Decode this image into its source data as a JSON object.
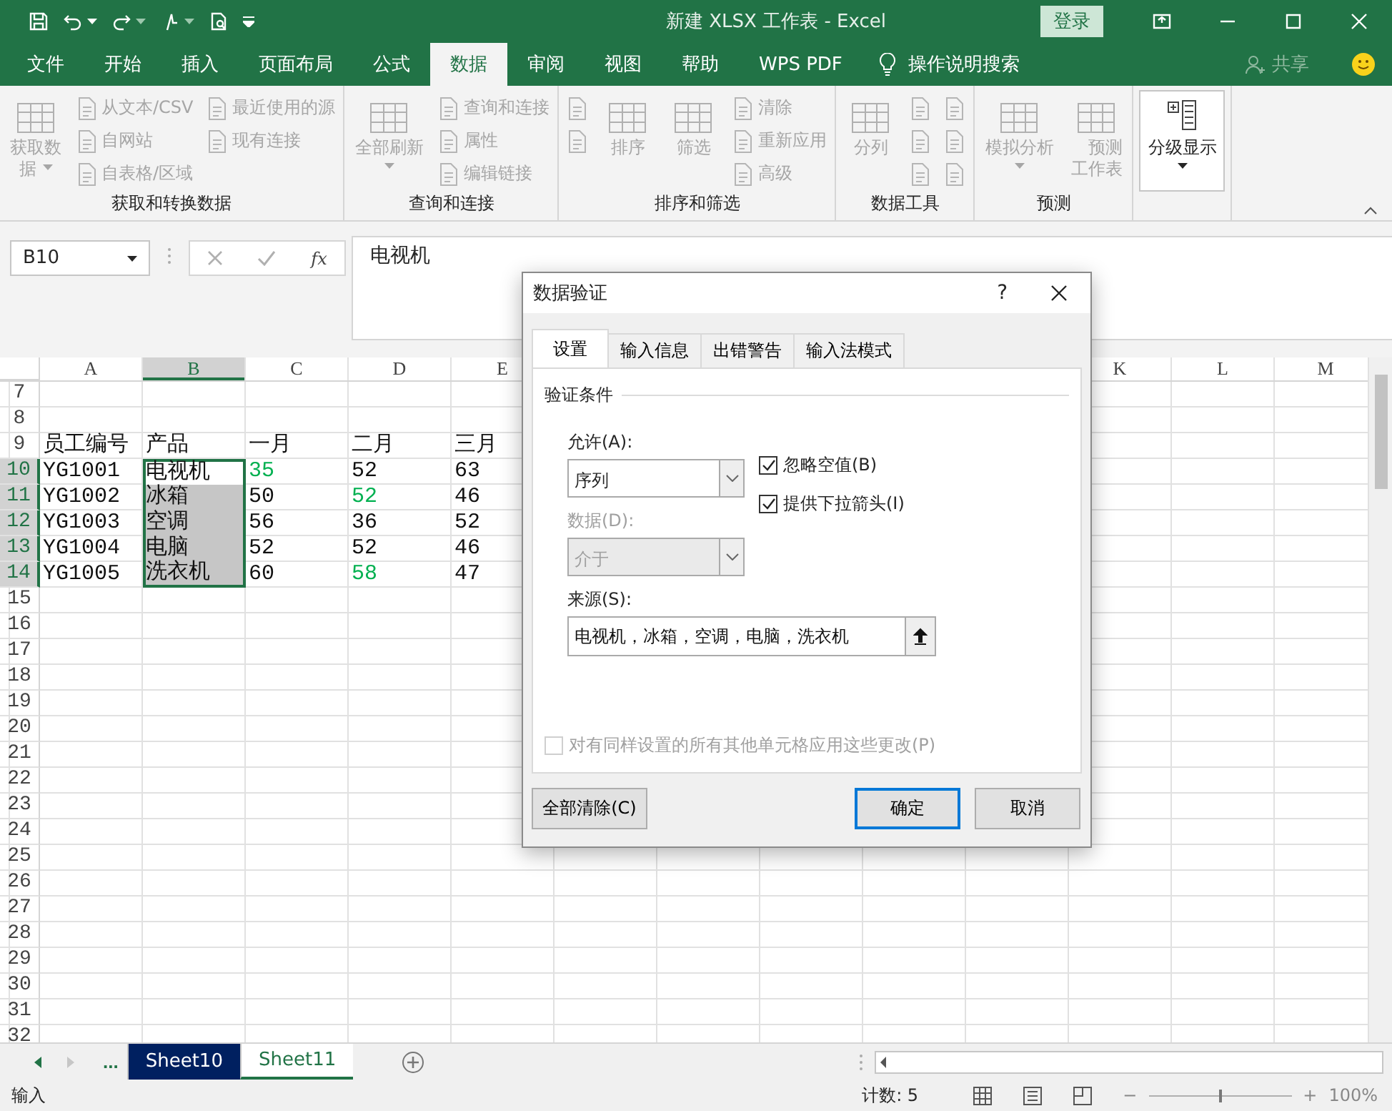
{
  "window": {
    "title": "新建 XLSX 工作表  -  Excel",
    "login": "登录"
  },
  "menu": {
    "tabs": [
      {
        "label": "文件",
        "selected": false
      },
      {
        "label": "开始",
        "selected": false
      },
      {
        "label": "插入",
        "selected": false
      },
      {
        "label": "页面布局",
        "selected": false
      },
      {
        "label": "公式",
        "selected": false
      },
      {
        "label": "数据",
        "selected": true
      },
      {
        "label": "审阅",
        "selected": false
      },
      {
        "label": "视图",
        "selected": false
      },
      {
        "label": "帮助",
        "selected": false
      },
      {
        "label": "WPS PDF",
        "selected": false
      }
    ],
    "search": "操作说明搜索",
    "share": "共享"
  },
  "ribbon": {
    "groups": [
      {
        "label": "获取和转换数据",
        "columns": [
          {
            "kind": "large",
            "label": "获取数据",
            "dropdown": true,
            "disabled": true
          },
          {
            "kind": "stack",
            "entries": [
              {
                "label": "从文本/CSV",
                "disabled": true
              },
              {
                "label": "自网站",
                "disabled": true
              },
              {
                "label": "自表格/区域",
                "disabled": true
              }
            ]
          },
          {
            "kind": "stack",
            "entries": [
              {
                "label": "最近使用的源",
                "disabled": true
              },
              {
                "label": "现有连接",
                "disabled": true
              }
            ]
          }
        ]
      },
      {
        "label": "查询和连接",
        "columns": [
          {
            "kind": "large",
            "label": "全部刷新",
            "dropdown": true,
            "disabled": true
          },
          {
            "kind": "stack",
            "entries": [
              {
                "label": "查询和连接",
                "disabled": true
              },
              {
                "label": "属性",
                "disabled": true
              },
              {
                "label": "编辑链接",
                "disabled": true
              }
            ]
          }
        ]
      },
      {
        "label": "排序和筛选",
        "columns": [
          {
            "kind": "stack",
            "entries": [
              {
                "disabled": true
              },
              {
                "disabled": true
              }
            ]
          },
          {
            "kind": "large",
            "label": "排序",
            "dropdown": false,
            "disabled": true
          },
          {
            "kind": "large",
            "label": "筛选",
            "dropdown": false,
            "disabled": true
          },
          {
            "kind": "stack",
            "entries": [
              {
                "label": "清除",
                "disabled": true
              },
              {
                "label": "重新应用",
                "disabled": true
              },
              {
                "label": "高级",
                "disabled": true
              }
            ]
          }
        ]
      },
      {
        "label": "数据工具",
        "columns": [
          {
            "kind": "large",
            "label": "分列",
            "dropdown": false,
            "disabled": true
          },
          {
            "kind": "stack",
            "entries": [
              {
                "disabled": true
              },
              {
                "disabled": true
              },
              {
                "disabled": true
              }
            ]
          },
          {
            "kind": "stack",
            "entries": [
              {
                "disabled": true
              },
              {
                "disabled": true
              },
              {
                "disabled": true
              }
            ]
          }
        ]
      },
      {
        "label": "预测",
        "columns": [
          {
            "kind": "large",
            "label": "模拟分析",
            "dropdown": true,
            "disabled": true
          },
          {
            "kind": "large",
            "label": "预测工作表",
            "dropdown": false,
            "disabled": true
          }
        ]
      },
      {
        "columns": [
          {
            "kind": "large",
            "label": "分级显示",
            "dropdown": true,
            "disabled": false
          }
        ]
      }
    ]
  },
  "formula_bar": {
    "name_box": "B10",
    "function_label": "fx",
    "content": "电视机"
  },
  "sheet": {
    "column_headers": [
      {
        "label": "A",
        "selected": false
      },
      {
        "label": "B",
        "selected": true
      },
      {
        "label": "C",
        "selected": false
      },
      {
        "label": "D",
        "selected": false
      },
      {
        "label": "E",
        "selected": false
      },
      {
        "label": "K",
        "selected": false
      },
      {
        "label": "L",
        "selected": false
      },
      {
        "label": "M",
        "selected": false
      }
    ],
    "rows": [
      {
        "number": "7",
        "selected": false
      },
      {
        "number": "8",
        "selected": false
      },
      {
        "number": "9",
        "selected": false,
        "cells": [
          {
            "text": "员工编号",
            "highlighted": false,
            "selected": false,
            "active": false
          },
          {
            "text": "产品",
            "highlighted": false,
            "selected": false,
            "active": false
          },
          {
            "text": "一月",
            "highlighted": false,
            "selected": false,
            "active": false
          },
          {
            "text": "二月",
            "highlighted": false,
            "selected": false,
            "active": false
          },
          {
            "text": "三月",
            "highlighted": false,
            "selected": false,
            "active": false
          }
        ]
      },
      {
        "number": "10",
        "selected": true,
        "cells": [
          {
            "text": "YG1001",
            "highlighted": false,
            "selected": false,
            "active": false
          },
          {
            "text": "电视机",
            "highlighted": false,
            "selected": true,
            "active": true
          },
          {
            "text": "35",
            "highlighted": true,
            "selected": false,
            "active": false
          },
          {
            "text": "52",
            "highlighted": false,
            "selected": false,
            "active": false
          },
          {
            "text": "63",
            "highlighted": false,
            "selected": false,
            "active": false
          }
        ]
      },
      {
        "number": "11",
        "selected": true,
        "cells": [
          {
            "text": "YG1002",
            "highlighted": false,
            "selected": false,
            "active": false
          },
          {
            "text": "冰箱",
            "highlighted": false,
            "selected": true,
            "active": false
          },
          {
            "text": "50",
            "highlighted": false,
            "selected": false,
            "active": false
          },
          {
            "text": "52",
            "highlighted": true,
            "selected": false,
            "active": false
          },
          {
            "text": "46",
            "highlighted": false,
            "selected": false,
            "active": false
          }
        ]
      },
      {
        "number": "12",
        "selected": true,
        "cells": [
          {
            "text": "YG1003",
            "highlighted": false,
            "selected": false,
            "active": false
          },
          {
            "text": "空调",
            "highlighted": false,
            "selected": true,
            "active": false
          },
          {
            "text": "56",
            "highlighted": false,
            "selected": false,
            "active": false
          },
          {
            "text": "36",
            "highlighted": false,
            "selected": false,
            "active": false
          },
          {
            "text": "52",
            "highlighted": false,
            "selected": false,
            "active": false
          }
        ]
      },
      {
        "number": "13",
        "selected": true,
        "cells": [
          {
            "text": "YG1004",
            "highlighted": false,
            "selected": false,
            "active": false
          },
          {
            "text": "电脑",
            "highlighted": false,
            "selected": true,
            "active": false
          },
          {
            "text": "52",
            "highlighted": false,
            "selected": false,
            "active": false
          },
          {
            "text": "52",
            "highlighted": false,
            "selected": false,
            "active": false
          },
          {
            "text": "46",
            "highlighted": false,
            "selected": false,
            "active": false
          }
        ]
      },
      {
        "number": "14",
        "selected": true,
        "cells": [
          {
            "text": "YG1005",
            "highlighted": false,
            "selected": false,
            "active": false
          },
          {
            "text": "洗衣机",
            "highlighted": false,
            "selected": true,
            "active": false
          },
          {
            "text": "60",
            "highlighted": false,
            "selected": false,
            "active": false
          },
          {
            "text": "58",
            "highlighted": true,
            "selected": false,
            "active": false
          },
          {
            "text": "47",
            "highlighted": false,
            "selected": false,
            "active": false
          }
        ]
      },
      {
        "number": "15",
        "selected": false
      },
      {
        "number": "16",
        "selected": false
      },
      {
        "number": "17",
        "selected": false
      },
      {
        "number": "18",
        "selected": false
      },
      {
        "number": "19",
        "selected": false
      },
      {
        "number": "20",
        "selected": false
      },
      {
        "number": "21",
        "selected": false
      },
      {
        "number": "22",
        "selected": false
      },
      {
        "number": "23",
        "selected": false
      },
      {
        "number": "24",
        "selected": false
      },
      {
        "number": "25",
        "selected": false
      },
      {
        "number": "26",
        "selected": false
      },
      {
        "number": "27",
        "selected": false
      },
      {
        "number": "28",
        "selected": false
      },
      {
        "number": "29",
        "selected": false
      },
      {
        "number": "30",
        "selected": false
      },
      {
        "number": "31",
        "selected": false
      },
      {
        "number": "32",
        "selected": false
      }
    ]
  },
  "dialog": {
    "title": "数据验证",
    "help": "?",
    "tabs": [
      {
        "label": "设置",
        "selected": true
      },
      {
        "label": "输入信息",
        "selected": false
      },
      {
        "label": "出错警告",
        "selected": false
      },
      {
        "label": "输入法模式",
        "selected": false
      }
    ],
    "section": "验证条件",
    "allow": {
      "label": "允许(A):",
      "value": "序列",
      "disabled": false
    },
    "data": {
      "label": "数据(D):",
      "value": "介于",
      "disabled": true
    },
    "checkboxes": [
      {
        "label": "忽略空值(B)",
        "checked": true
      },
      {
        "label": "提供下拉箭头(I)",
        "checked": true
      }
    ],
    "source": {
      "label": "来源(S):",
      "value": "电视机，冰箱，空调，电脑，洗衣机"
    },
    "apply_all": {
      "label": "对有同样设置的所有其他单元格应用这些更改(P)",
      "checked": false,
      "disabled": true
    },
    "buttons": [
      {
        "label": "全部清除(C)",
        "default": false
      },
      {
        "label": "确定",
        "default": true
      },
      {
        "label": "取消",
        "default": false
      }
    ]
  },
  "sheet_tabs": {
    "more": "...",
    "tabs": [
      {
        "label": "Sheet10",
        "selected": false,
        "color": "#002060"
      },
      {
        "label": "Sheet11",
        "selected": true
      }
    ]
  },
  "status_bar": {
    "mode": "输入",
    "count": "计数: 5",
    "zoom": {
      "minus": "−",
      "plus": "+",
      "level": 0.5,
      "label": "100%"
    }
  }
}
